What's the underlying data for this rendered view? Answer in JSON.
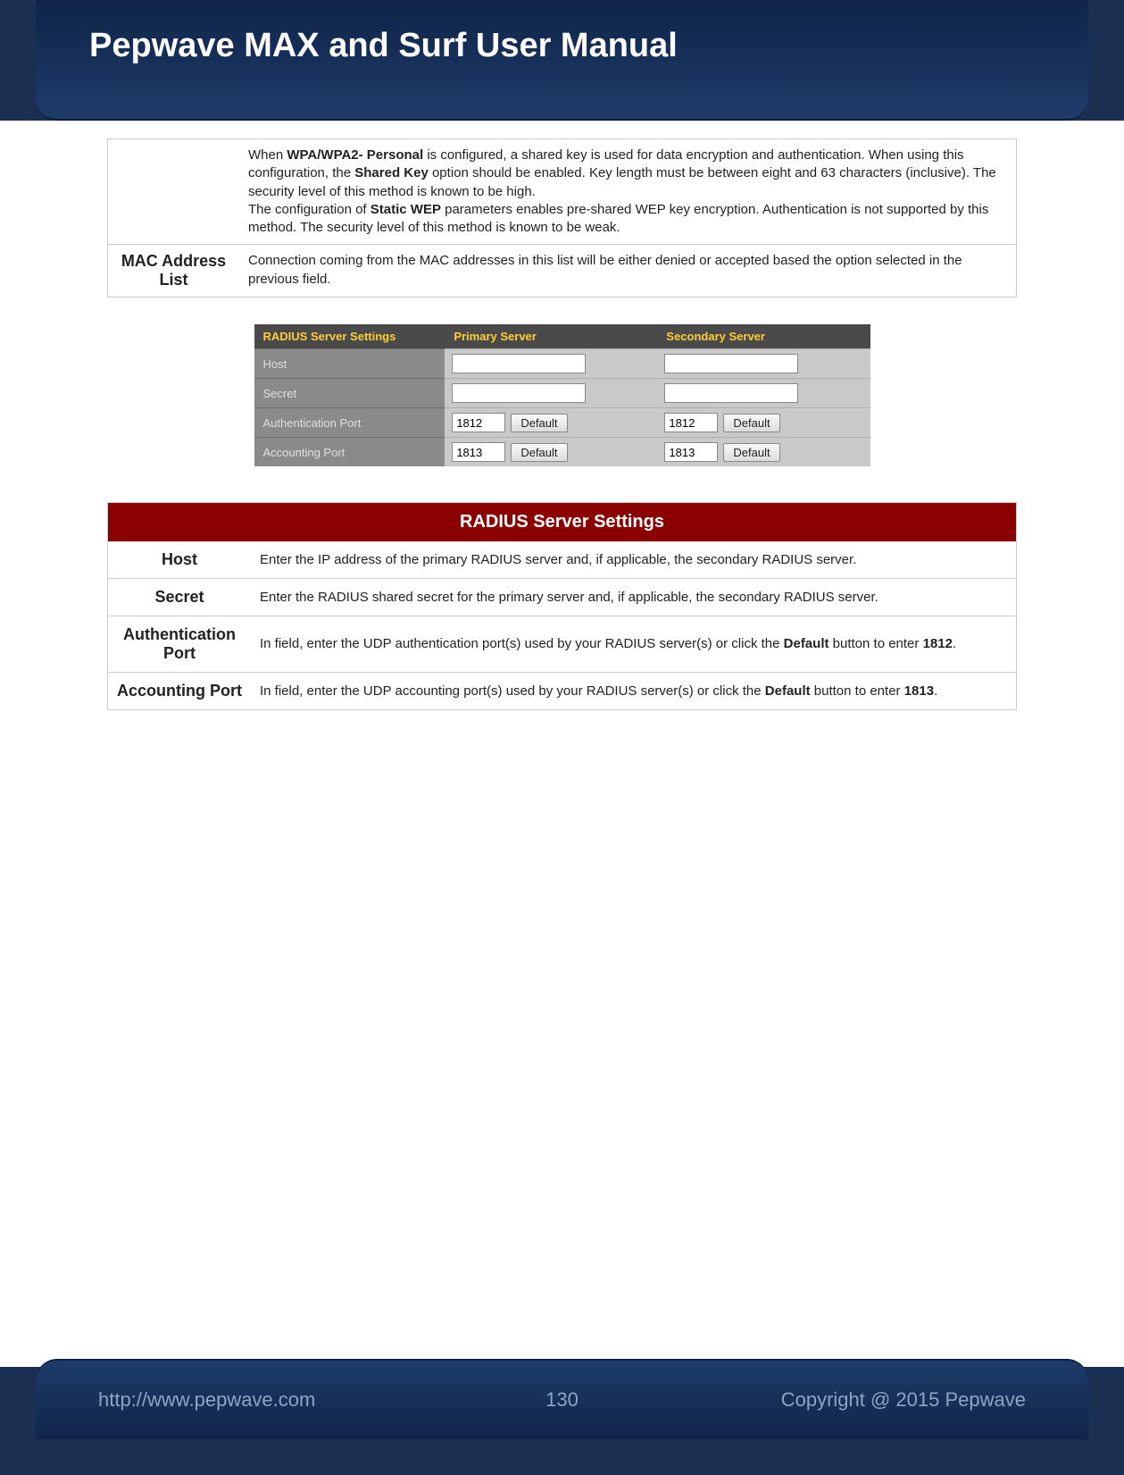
{
  "header": {
    "title": "Pepwave MAX and Surf User Manual"
  },
  "table1": {
    "row1": {
      "label": "",
      "text_parts": {
        "p1a": "When ",
        "p1b": "WPA/WPA2- Personal",
        "p1c": " is configured, a shared key is used for data encryption and authentication. When using this configuration, the ",
        "p1d": "Shared Key",
        "p1e": " option should be enabled. Key length must be between eight and 63 characters (inclusive). The security level of this method is known to be high.",
        "p2a": "The configuration of ",
        "p2b": "Static WEP",
        "p2c": " parameters enables pre-shared WEP key encryption. Authentication is not supported by this method. The security level of this method is known to be weak."
      }
    },
    "row2": {
      "label": "MAC Address List",
      "text": "Connection coming from the MAC addresses in this list will be either denied or accepted based the option selected in the previous field."
    }
  },
  "radius_screenshot": {
    "title": "RADIUS Server Settings",
    "col1": "Primary Server",
    "col2": "Secondary Server",
    "rows": [
      {
        "label": "Host",
        "type": "text",
        "p_val": "",
        "s_val": ""
      },
      {
        "label": "Secret",
        "type": "text",
        "p_val": "",
        "s_val": ""
      },
      {
        "label": "Authentication Port",
        "type": "port",
        "p_val": "1812",
        "s_val": "1812",
        "btn": "Default"
      },
      {
        "label": "Accounting Port",
        "type": "port",
        "p_val": "1813",
        "s_val": "1813",
        "btn": "Default"
      }
    ]
  },
  "table2": {
    "header": "RADIUS Server Settings",
    "rows": {
      "host": {
        "label": "Host",
        "text": "Enter the IP address of the primary RADIUS server and, if applicable, the secondary RADIUS server."
      },
      "secret": {
        "label": "Secret",
        "text": "Enter the RADIUS shared secret for the primary server and, if applicable, the secondary RADIUS server."
      },
      "auth": {
        "label": "Authentication Port",
        "ta": "In field, enter the UDP authentication port(s) used by your RADIUS server(s) or click the ",
        "tb": "Default",
        "tc": " button to enter ",
        "td": "1812",
        "te": "."
      },
      "acct": {
        "label": "Accounting Port",
        "ta": "In field, enter the UDP accounting port(s) used by your RADIUS server(s) or click the ",
        "tb": "Default",
        "tc": " button to enter ",
        "td": "1813",
        "te": "."
      }
    }
  },
  "footer": {
    "url": "http://www.pepwave.com",
    "page": "130",
    "copyright": "Copyright @ 2015 Pepwave"
  }
}
